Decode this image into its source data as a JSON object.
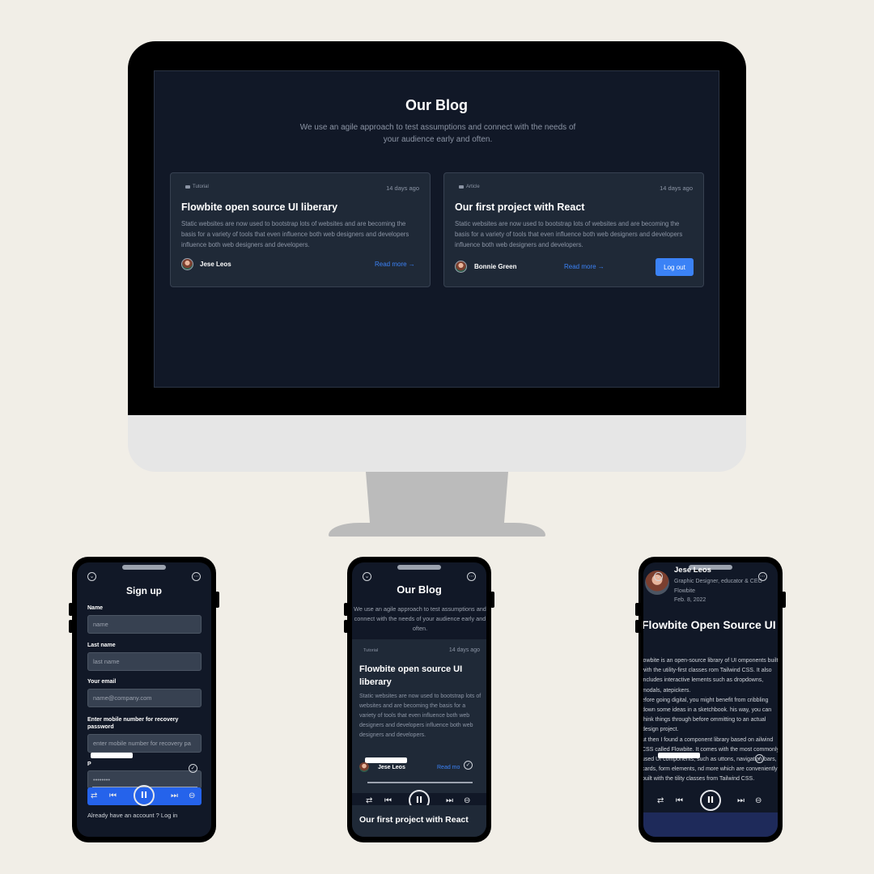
{
  "desktop": {
    "title": "Our Blog",
    "subtitle": "We use an agile approach to test assumptions and connect with the needs of your audience early and often.",
    "cards": [
      {
        "tag": "Tutorial",
        "age": "14 days ago",
        "title": "Flowbite open source UI liberary",
        "text": "Static websites are now used to bootstrap lots of websites and are becoming the basis for a variety of tools that even influence both web designers and developers influence both web designers and developers.",
        "author": "Jese Leos",
        "read_more": "Read more →"
      },
      {
        "tag": "Article",
        "age": "14 days ago",
        "title": "Our first project with React",
        "text": "Static websites are now used to bootstrap lots of websites and are becoming the basis for a variety of tools that even influence both web designers and developers influence both web designers and developers.",
        "author": "Bonnie Green",
        "read_more": "Read more →",
        "logout": "Log out"
      }
    ]
  },
  "phone_signup": {
    "title": "Sign up",
    "fields": [
      {
        "label": "Name",
        "placeholder": "name"
      },
      {
        "label": "Last name",
        "placeholder": "last name"
      },
      {
        "label": "Your email",
        "placeholder": "name@company.com"
      },
      {
        "label": "Enter mobile number for recovery password",
        "placeholder": "enter mobile number for recovery pa"
      },
      {
        "label": "P",
        "value": "••••••••"
      }
    ],
    "footer": "Already have an account ? Log in"
  },
  "phone_blog": {
    "title": "Our Blog",
    "subtitle": "We use an agile approach to test assumptions and connect with the needs of your audience early and often.",
    "card": {
      "tag": "Tutorial",
      "age": "14 days ago",
      "title": "Flowbite open source UI liberary",
      "text": "Static websites are now used to bootstrap lots of websites and are becoming the basis for a variety of tools that even influence both web designers and developers influence both web designers and developers.",
      "author": "Jese Leos",
      "read_more": "Read mo"
    },
    "card2_title": "Our first project with React"
  },
  "phone_article": {
    "author": "Jese Leos",
    "role": "Graphic Designer, educator & CEO Flowbite",
    "date": "Feb. 8, 2022",
    "title": "Flowbite Open Source UI",
    "body": "lowbite is an open-source library of UI omponents built with the utility-first classes rom Tailwind CSS. It also includes interactive lements such as dropdowns, modals, atepickers.\nefore going digital, you might benefit from cribbling down some ideas in a sketchbook. his way, you can think things through before ommitting to an actual design project.\nut then I found a component library based on ailwind CSS called Flowbite. It comes with the most commonly used UI components, such as uttons, navigation bars, cards, form elements, nd more which are conveniently built with the tility classes from Tailwind CSS."
  },
  "player": {
    "repeat_icon": "⇄",
    "prev_icon": "⏮",
    "play_icon": "II",
    "next_icon": "⏭",
    "more_icon": "⊖"
  },
  "colors": {
    "page_bg": "#f1eee7",
    "screen_bg": "#111827",
    "card_bg": "#1f2937",
    "accent": "#3b82f6"
  }
}
